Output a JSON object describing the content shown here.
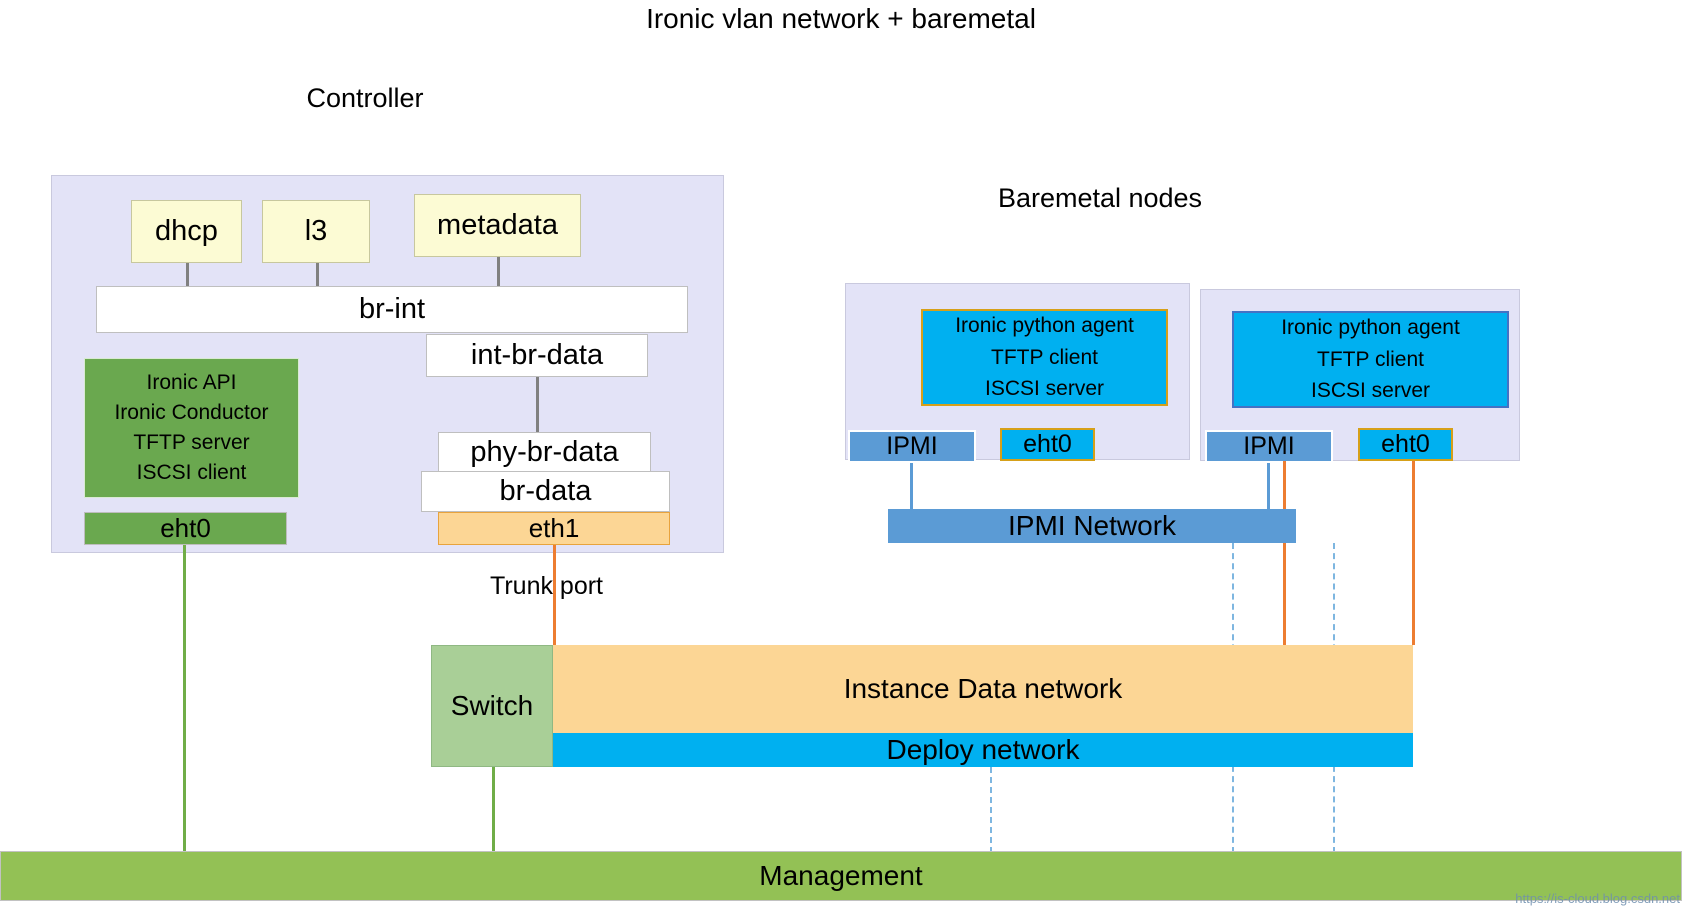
{
  "diagram": {
    "title": "Ironic vlan network + baremetal",
    "watermark": "https://is-cloud.blog.csdn.net"
  },
  "controller": {
    "title": "Controller",
    "agents": [
      {
        "label": "dhcp"
      },
      {
        "label": "l3"
      },
      {
        "label": "metadata"
      }
    ],
    "bridges": [
      {
        "label": "br-int"
      },
      {
        "label": "int-br-data"
      },
      {
        "label": "phy-br-data"
      },
      {
        "label": "br-data"
      }
    ],
    "services_box": {
      "lines": [
        "Ironic API",
        "Ironic Conductor",
        "TFTP server",
        "ISCSI client"
      ]
    },
    "ports": [
      {
        "label": "eht0"
      },
      {
        "label": "eth1"
      }
    ],
    "trunk_port_label": "Trunk port"
  },
  "baremetal": {
    "title": "Baremetal nodes",
    "nodes": [
      {
        "agent_lines": [
          "Ironic python agent",
          "TFTP client",
          "ISCSI server"
        ],
        "ipmi_label": "IPMI",
        "nic_label": "eht0"
      },
      {
        "agent_lines": [
          "Ironic python agent",
          "TFTP client",
          "ISCSI server"
        ],
        "ipmi_label": "IPMI",
        "nic_label": "eht0"
      }
    ]
  },
  "networks": {
    "ipmi": "IPMI Network",
    "switch": "Switch",
    "instance_data": "Instance Data network",
    "deploy": "Deploy network",
    "management": "Management"
  },
  "colors": {
    "panel_bg": "#e3e3f7",
    "agent_yellow": "#fcfbd4",
    "service_green": "#6aa84f",
    "nic_orange": "#fcd695",
    "cyan": "#00b0f0",
    "ipmi_blue": "#5b9bd5",
    "switch_green": "#a9cf97",
    "management_green": "#93c155",
    "connector_orange": "#ed7d31",
    "connector_green": "#70ad47"
  }
}
